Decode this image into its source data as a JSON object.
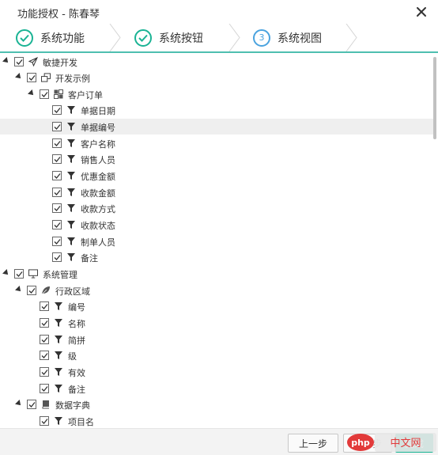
{
  "dialog": {
    "title": "功能授权 - 陈春琴"
  },
  "steps": [
    {
      "label": "系统功能",
      "state": "done"
    },
    {
      "label": "系统按钮",
      "state": "done"
    },
    {
      "label": "系统视图",
      "state": "active",
      "number": "3"
    }
  ],
  "tree": [
    {
      "id": "n0",
      "level": 0,
      "toggle": true,
      "icon": "paper-plane-icon",
      "label": "敏捷开发"
    },
    {
      "id": "n1",
      "level": 1,
      "toggle": true,
      "icon": "clone-icon",
      "label": "开发示例"
    },
    {
      "id": "n2",
      "level": 2,
      "toggle": true,
      "icon": "cubes-icon",
      "label": "客户订单"
    },
    {
      "id": "n3",
      "level": 3,
      "toggle": false,
      "icon": "filter-icon",
      "label": "单据日期"
    },
    {
      "id": "n4",
      "level": 3,
      "toggle": false,
      "icon": "filter-icon",
      "label": "单据编号",
      "highlight": true
    },
    {
      "id": "n5",
      "level": 3,
      "toggle": false,
      "icon": "filter-icon",
      "label": "客户名称"
    },
    {
      "id": "n6",
      "level": 3,
      "toggle": false,
      "icon": "filter-icon",
      "label": "销售人员"
    },
    {
      "id": "n7",
      "level": 3,
      "toggle": false,
      "icon": "filter-icon",
      "label": "优惠金额"
    },
    {
      "id": "n8",
      "level": 3,
      "toggle": false,
      "icon": "filter-icon",
      "label": "收款金额"
    },
    {
      "id": "n9",
      "level": 3,
      "toggle": false,
      "icon": "filter-icon",
      "label": "收款方式"
    },
    {
      "id": "n10",
      "level": 3,
      "toggle": false,
      "icon": "filter-icon",
      "label": "收款状态"
    },
    {
      "id": "n11",
      "level": 3,
      "toggle": false,
      "icon": "filter-icon",
      "label": "制单人员"
    },
    {
      "id": "n12",
      "level": 3,
      "toggle": false,
      "icon": "filter-icon",
      "label": "备注"
    },
    {
      "id": "n13",
      "level": 0,
      "toggle": true,
      "icon": "desktop-icon",
      "label": "系统管理"
    },
    {
      "id": "n14",
      "level": 1,
      "toggle": true,
      "icon": "leaf-icon",
      "label": "行政区域"
    },
    {
      "id": "n15",
      "level": 2,
      "toggle": false,
      "icon": "filter-icon",
      "label": "编号"
    },
    {
      "id": "n16",
      "level": 2,
      "toggle": false,
      "icon": "filter-icon",
      "label": "名称"
    },
    {
      "id": "n17",
      "level": 2,
      "toggle": false,
      "icon": "filter-icon",
      "label": "简拼"
    },
    {
      "id": "n18",
      "level": 2,
      "toggle": false,
      "icon": "filter-icon",
      "label": "级"
    },
    {
      "id": "n19",
      "level": 2,
      "toggle": false,
      "icon": "filter-icon",
      "label": "有效"
    },
    {
      "id": "n20",
      "level": 2,
      "toggle": false,
      "icon": "filter-icon",
      "label": "备注"
    },
    {
      "id": "n21",
      "level": 1,
      "toggle": true,
      "icon": "book-icon",
      "label": "数据字典"
    },
    {
      "id": "n22",
      "level": 2,
      "toggle": false,
      "icon": "filter-icon",
      "label": "项目名"
    }
  ],
  "footer": {
    "prev_label": "上一步",
    "next_label": "下一步",
    "finish_label": "完成",
    "watermark": "php中文网"
  },
  "colors": {
    "accent": "#1ab394",
    "active_step": "#4aa3df",
    "step_underline": "#4fbfb0"
  }
}
